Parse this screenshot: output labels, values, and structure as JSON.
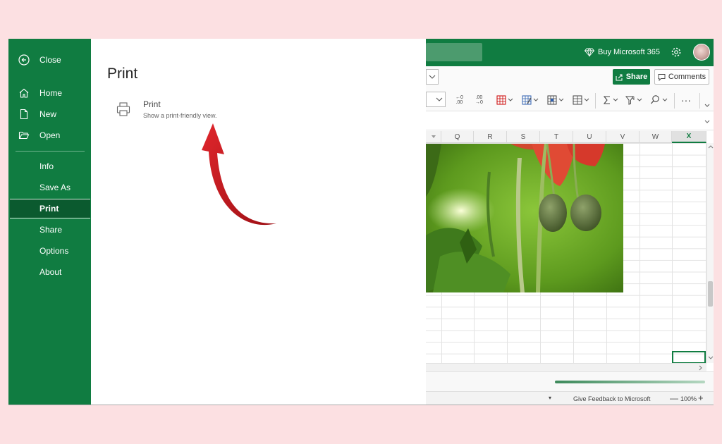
{
  "backstage": {
    "nav": {
      "close": "Close",
      "home": "Home",
      "new": "New",
      "open": "Open",
      "info": "Info",
      "save_as": "Save As",
      "print": "Print",
      "share": "Share",
      "options": "Options",
      "about": "About"
    },
    "pane": {
      "title": "Print",
      "option_title": "Print",
      "option_desc": "Show a print-friendly view."
    }
  },
  "excel": {
    "header": {
      "buy_label": "Buy Microsoft 365"
    },
    "ribbon": {
      "share_label": "Share",
      "comments_label": "Comments",
      "inc_decimal_top": "←0",
      "inc_decimal_bottom": ".00",
      "dec_decimal_top": ".00",
      "dec_decimal_bottom": "→0",
      "more_label": "···"
    },
    "columns": [
      "Q",
      "R",
      "S",
      "T",
      "U",
      "V",
      "W",
      "X"
    ],
    "selected_column": "X",
    "status": {
      "feedback": "Give Feedback to Microsoft",
      "zoom_minus": "—",
      "zoom": "100%",
      "zoom_plus": "+"
    }
  },
  "colors": {
    "excel_green": "#107c41",
    "nav_selected": "#0b5a2f",
    "annotation_arrow": "#c8161d",
    "background": "#fce0e2"
  }
}
